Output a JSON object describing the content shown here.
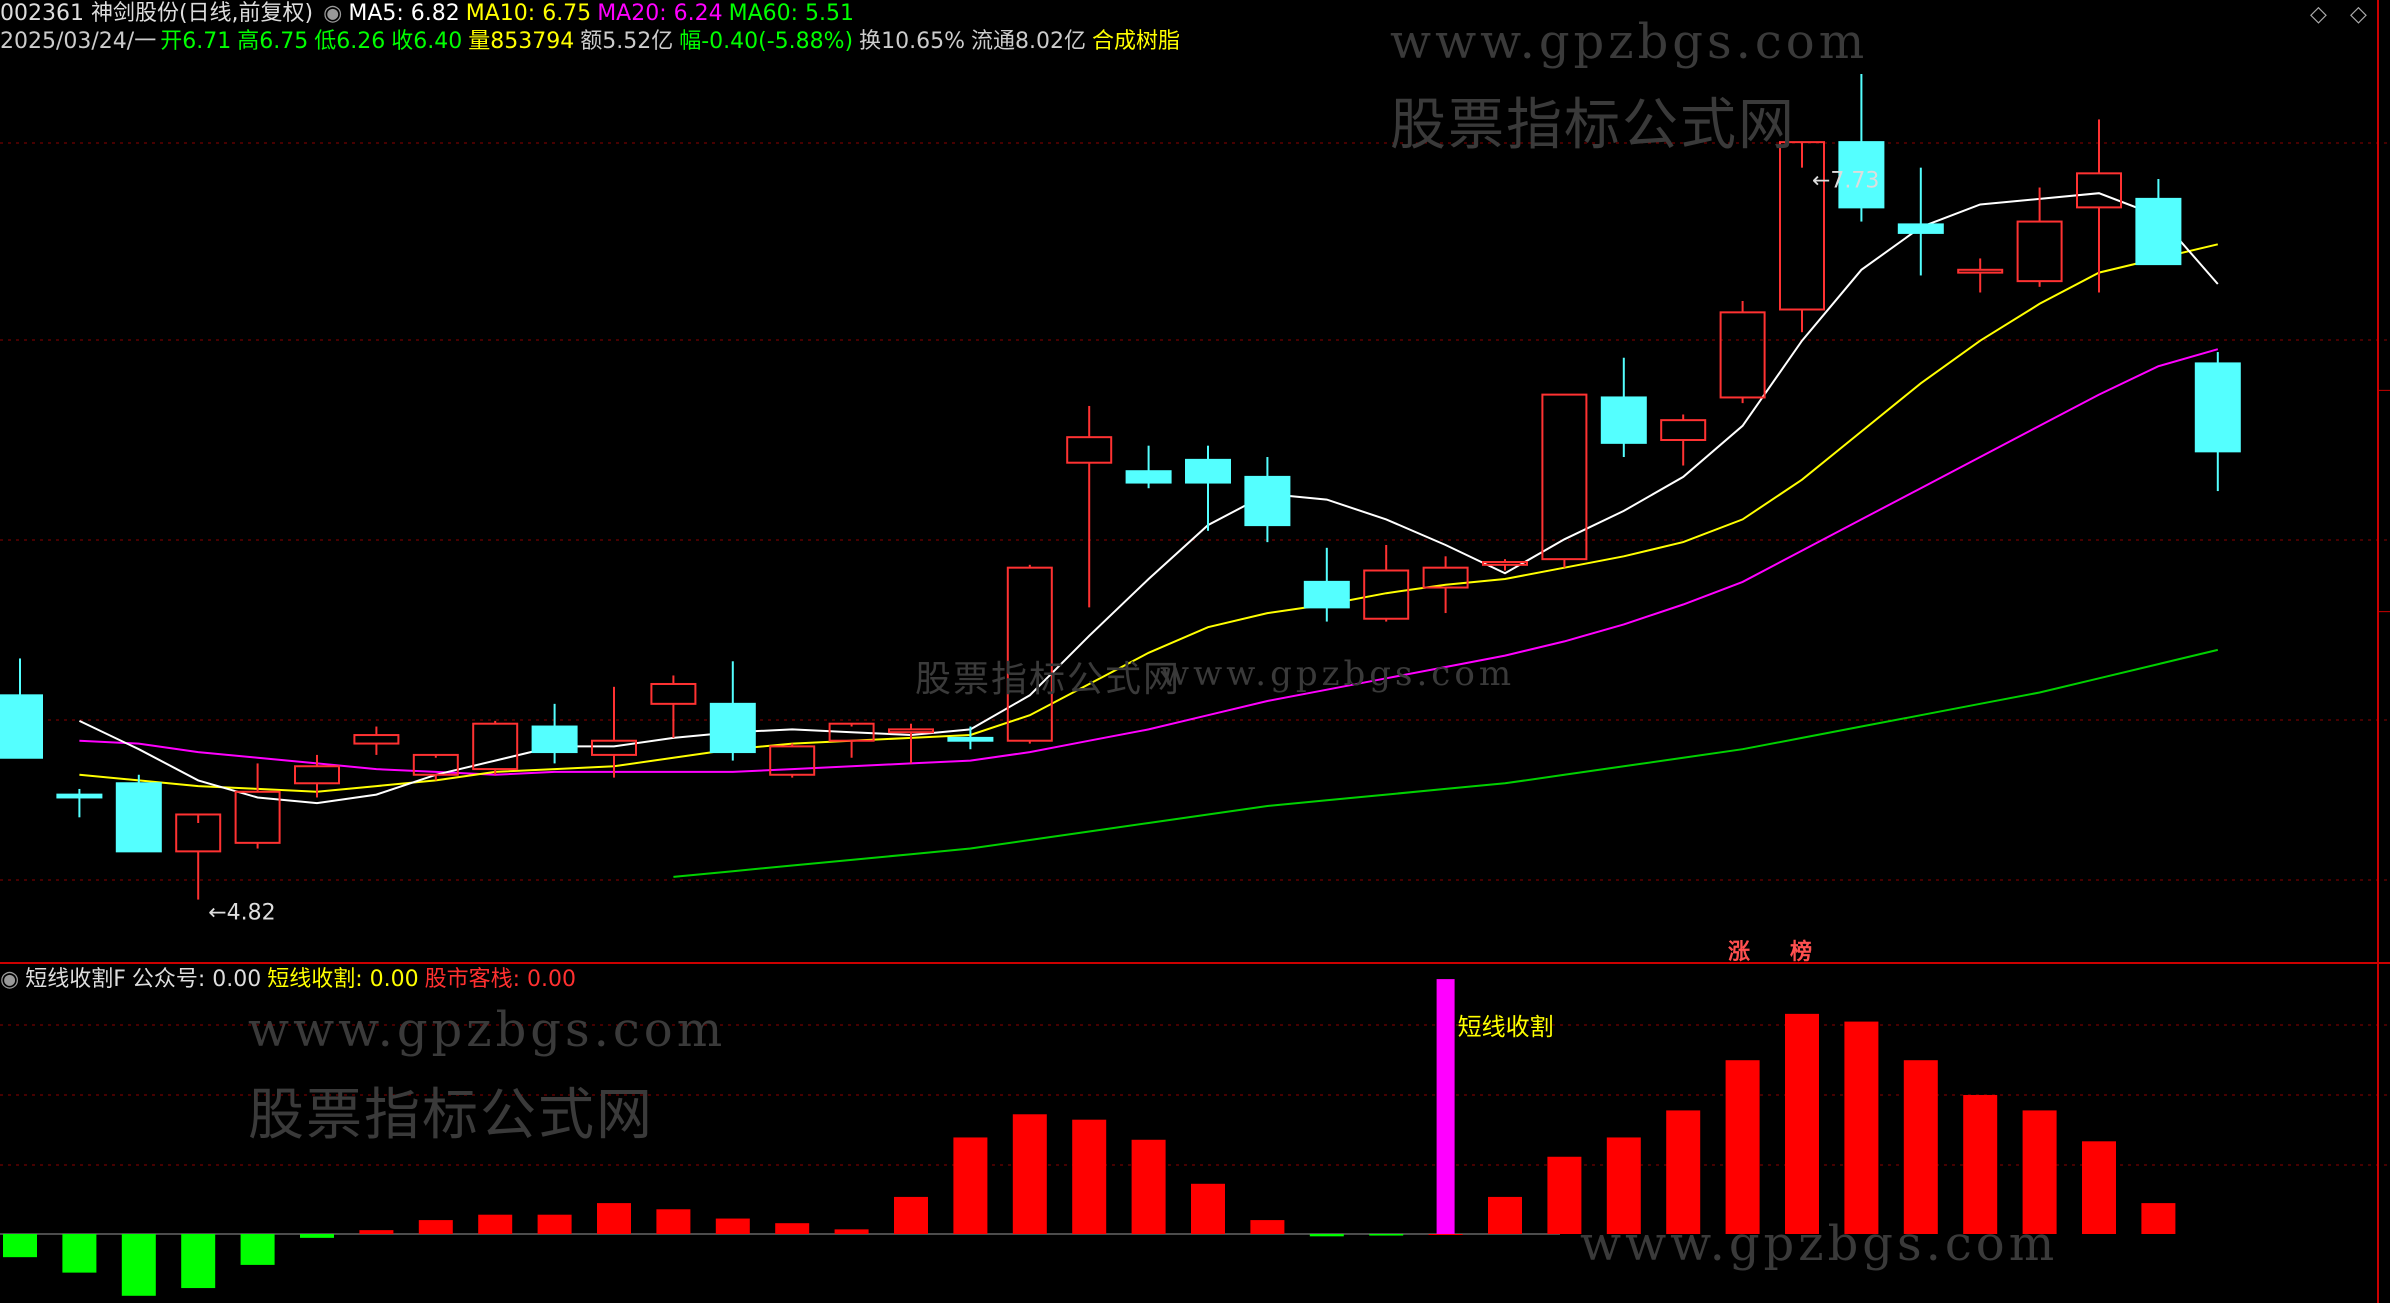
{
  "header": {
    "code_name": "002361 神剑股份(日线,前复权)",
    "ma5": "MA5: 6.82",
    "ma10": "MA10: 6.75",
    "ma20": "MA20: 6.24",
    "ma60": "MA60: 5.51",
    "date": "2025/03/24/一",
    "open": "开6.71",
    "high": "高6.75",
    "low": "低6.26",
    "close": "收6.40",
    "volume": "量853794",
    "amount": "额5.52亿",
    "change": "幅-0.40(-5.88%)",
    "turnover": "换10.65%",
    "float_cap": "流通8.02亿",
    "concept": "合成树脂"
  },
  "indicator_header": {
    "name": "短线收割F",
    "gzh": "公众号: 0.00",
    "dxsg": "短线收割: 0.00",
    "gskz": "股市客栈: 0.00"
  },
  "watermarks": {
    "url": "www.gpzbgs.com",
    "cn": "股票指标公式网"
  },
  "badges": {
    "zhang": "涨",
    "bang": "榜"
  },
  "icons": {
    "settings": "diamond-icon",
    "toggle": "circle-toggle-icon"
  },
  "colors": {
    "up": "#ff3232",
    "down": "#54ffff",
    "ma5": "#ffffff",
    "ma10": "#ffff00",
    "ma20": "#ff00ff",
    "ma60": "#00d000",
    "grid": "#8b0000",
    "bar_pos": "#ff0000",
    "bar_neg": "#00ff00",
    "signal": "#ff00ff"
  },
  "chart_data": [
    {
      "type": "candlestick",
      "title": "002361 神剑股份(日线,前复权)",
      "ylim": [
        4.6,
        7.85
      ],
      "annotations": [
        {
          "label": "7.73",
          "at_index": 30,
          "kind": "high"
        },
        {
          "label": "4.82",
          "at_index": 3,
          "kind": "low"
        }
      ],
      "candles": [
        {
          "o": 5.54,
          "h": 5.67,
          "l": 5.41,
          "c": 5.32
        },
        {
          "o": 5.19,
          "h": 5.21,
          "l": 5.11,
          "c": 5.18
        },
        {
          "o": 5.23,
          "h": 5.26,
          "l": 5.0,
          "c": 4.99
        },
        {
          "o": 4.99,
          "h": 5.09,
          "l": 4.82,
          "c": 5.12
        },
        {
          "o": 5.02,
          "h": 5.3,
          "l": 5.0,
          "c": 5.2
        },
        {
          "o": 5.23,
          "h": 5.33,
          "l": 5.18,
          "c": 5.29
        },
        {
          "o": 5.37,
          "h": 5.43,
          "l": 5.33,
          "c": 5.4
        },
        {
          "o": 5.26,
          "h": 5.32,
          "l": 5.24,
          "c": 5.33
        },
        {
          "o": 5.28,
          "h": 5.45,
          "l": 5.26,
          "c": 5.44
        },
        {
          "o": 5.43,
          "h": 5.51,
          "l": 5.3,
          "c": 5.34
        },
        {
          "o": 5.33,
          "h": 5.57,
          "l": 5.25,
          "c": 5.38
        },
        {
          "o": 5.51,
          "h": 5.61,
          "l": 5.39,
          "c": 5.58
        },
        {
          "o": 5.51,
          "h": 5.66,
          "l": 5.31,
          "c": 5.34
        },
        {
          "o": 5.26,
          "h": 5.37,
          "l": 5.25,
          "c": 5.36
        },
        {
          "o": 5.38,
          "h": 5.43,
          "l": 5.32,
          "c": 5.44
        },
        {
          "o": 5.41,
          "h": 5.44,
          "l": 5.3,
          "c": 5.42
        },
        {
          "o": 5.39,
          "h": 5.43,
          "l": 5.35,
          "c": 5.38
        },
        {
          "o": 5.38,
          "h": 6.0,
          "l": 5.37,
          "c": 5.99
        },
        {
          "o": 6.36,
          "h": 6.56,
          "l": 5.85,
          "c": 6.45
        },
        {
          "o": 6.33,
          "h": 6.42,
          "l": 6.27,
          "c": 6.29
        },
        {
          "o": 6.37,
          "h": 6.42,
          "l": 6.12,
          "c": 6.29
        },
        {
          "o": 6.31,
          "h": 6.38,
          "l": 6.08,
          "c": 6.14
        },
        {
          "o": 5.94,
          "h": 6.06,
          "l": 5.8,
          "c": 5.85
        },
        {
          "o": 5.81,
          "h": 6.07,
          "l": 5.8,
          "c": 5.98
        },
        {
          "o": 5.92,
          "h": 6.03,
          "l": 5.83,
          "c": 5.99
        },
        {
          "o": 6.0,
          "h": 6.02,
          "l": 5.98,
          "c": 6.01
        },
        {
          "o": 6.02,
          "h": 6.6,
          "l": 5.99,
          "c": 6.6
        },
        {
          "o": 6.59,
          "h": 6.73,
          "l": 6.38,
          "c": 6.43
        },
        {
          "o": 6.44,
          "h": 6.53,
          "l": 6.35,
          "c": 6.51
        },
        {
          "o": 6.59,
          "h": 6.93,
          "l": 6.57,
          "c": 6.89
        },
        {
          "o": 6.9,
          "h": 7.4,
          "l": 6.82,
          "c": 7.49
        },
        {
          "o": 7.49,
          "h": 7.73,
          "l": 7.21,
          "c": 7.26
        },
        {
          "o": 7.2,
          "h": 7.4,
          "l": 7.02,
          "c": 7.17
        },
        {
          "o": 7.03,
          "h": 7.08,
          "l": 6.96,
          "c": 7.04
        },
        {
          "o": 7.0,
          "h": 7.33,
          "l": 6.98,
          "c": 7.21
        },
        {
          "o": 7.26,
          "h": 7.57,
          "l": 6.96,
          "c": 7.38
        },
        {
          "o": 7.29,
          "h": 7.36,
          "l": 7.11,
          "c": 7.06
        },
        {
          "o": 6.71,
          "h": 6.75,
          "l": 6.26,
          "c": 6.4
        }
      ],
      "ma5": [
        null,
        5.45,
        5.35,
        5.24,
        5.18,
        5.16,
        5.19,
        5.26,
        5.31,
        5.36,
        5.36,
        5.39,
        5.41,
        5.42,
        5.41,
        5.4,
        5.42,
        5.54,
        5.75,
        5.95,
        6.14,
        6.25,
        6.23,
        6.16,
        6.07,
        5.97,
        6.09,
        6.19,
        6.31,
        6.49,
        6.79,
        7.04,
        7.19,
        7.27,
        7.29,
        7.31,
        7.23,
        6.99
      ],
      "ma10": [
        null,
        5.26,
        5.24,
        5.22,
        5.21,
        5.2,
        5.22,
        5.24,
        5.27,
        5.28,
        5.29,
        5.32,
        5.35,
        5.37,
        5.38,
        5.39,
        5.4,
        5.47,
        5.58,
        5.69,
        5.78,
        5.83,
        5.86,
        5.9,
        5.93,
        5.95,
        5.99,
        6.03,
        6.08,
        6.16,
        6.3,
        6.47,
        6.64,
        6.79,
        6.92,
        7.03,
        7.08,
        7.13
      ],
      "ma20": [
        null,
        5.38,
        5.37,
        5.34,
        5.32,
        5.3,
        5.28,
        5.27,
        5.26,
        5.27,
        5.27,
        5.27,
        5.27,
        5.28,
        5.29,
        5.3,
        5.31,
        5.34,
        5.38,
        5.42,
        5.47,
        5.52,
        5.56,
        5.6,
        5.64,
        5.68,
        5.73,
        5.79,
        5.86,
        5.94,
        6.05,
        6.16,
        6.27,
        6.38,
        6.49,
        6.6,
        6.7,
        6.76
      ],
      "ma60": [
        null,
        null,
        null,
        null,
        null,
        null,
        null,
        null,
        null,
        null,
        null,
        4.9,
        4.92,
        4.94,
        4.96,
        4.98,
        5.0,
        5.03,
        5.06,
        5.09,
        5.12,
        5.15,
        5.17,
        5.19,
        5.21,
        5.23,
        5.26,
        5.29,
        5.32,
        5.35,
        5.39,
        5.43,
        5.47,
        5.51,
        5.55,
        5.6,
        5.65,
        5.7
      ]
    },
    {
      "type": "bar",
      "title": "短线收割F",
      "ylim": [
        -0.8,
        2.9
      ],
      "values": [
        -0.3,
        -0.5,
        -0.8,
        -0.7,
        -0.4,
        -0.05,
        0.05,
        0.18,
        0.25,
        0.25,
        0.4,
        0.32,
        0.2,
        0.14,
        0.06,
        0.48,
        1.25,
        1.55,
        1.48,
        1.22,
        0.65,
        0.18,
        -0.03,
        -0.02,
        0.0,
        0.48,
        1.0,
        1.25,
        1.6,
        2.25,
        2.85,
        2.75,
        2.25,
        1.8,
        1.6,
        1.2,
        0.4
      ],
      "signal": {
        "index": 24,
        "value": 3.3,
        "label": "短线收割"
      }
    }
  ]
}
